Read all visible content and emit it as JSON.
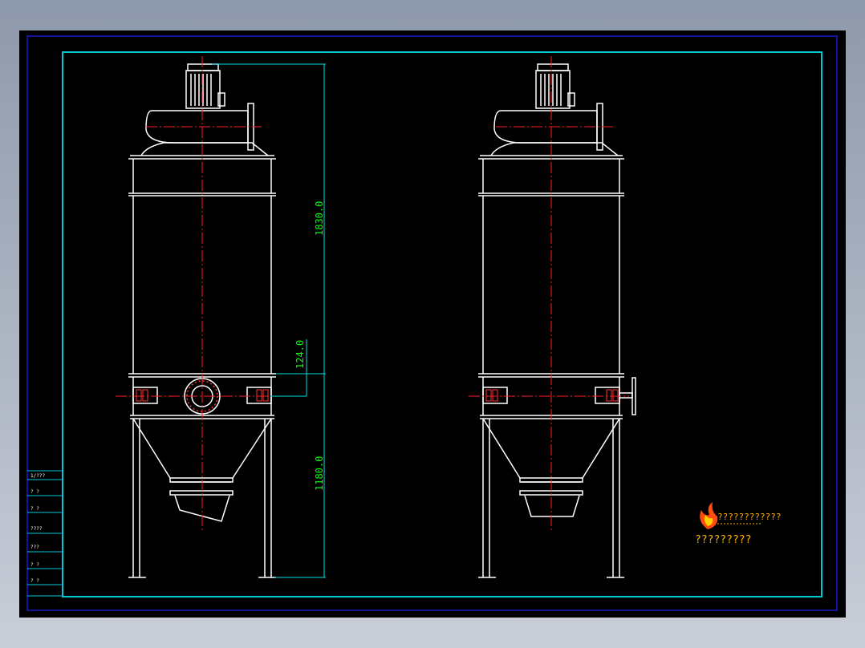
{
  "colors": {
    "background": "#000000",
    "outer_frame": "#1a1acc",
    "drawing_frame": "#00c8d8",
    "object_lines": "#ffffff",
    "center_lines": "#ff2020",
    "dimension_lines": "#00e0e0",
    "dimension_text": "#00ff00",
    "logo_text": "#ffb000",
    "hidden_lines": "#ff3333"
  },
  "dimensions": {
    "upper_height": "1830.0",
    "middle_height": "124.0",
    "lower_height": "1180.0"
  },
  "side_table": {
    "rows": [
      "1/???",
      "? ?",
      "? ?",
      "????",
      "???",
      "? ?",
      "? ?"
    ]
  },
  "logo": {
    "icon": "flame-logo-icon",
    "line1": "????????????",
    "line2": "?????????"
  },
  "views": [
    "front-view",
    "side-view"
  ]
}
